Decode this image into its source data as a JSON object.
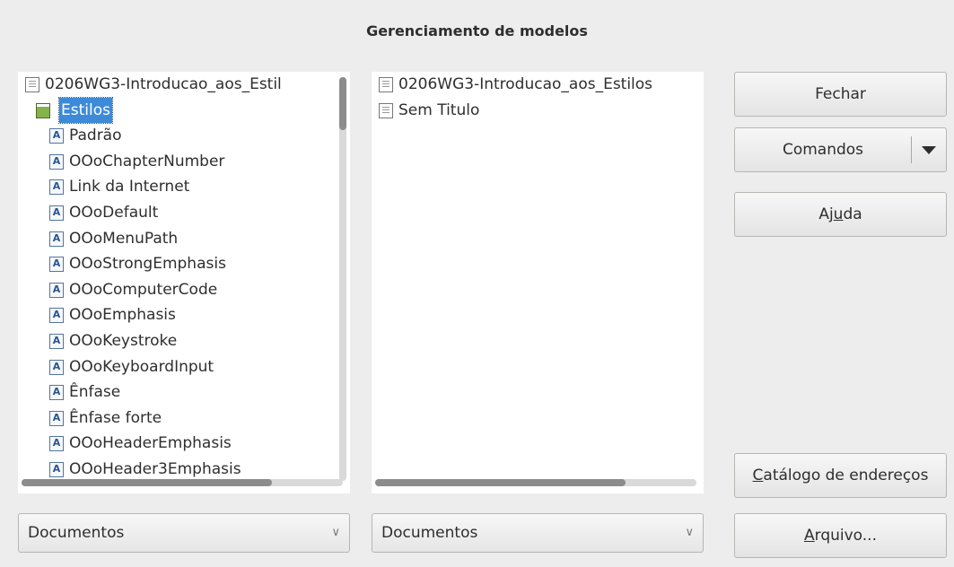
{
  "dialog": {
    "title": "Gerenciamento de modelos"
  },
  "left_list": {
    "document": "0206WG3-Introducao_aos_Estil",
    "folder": "Estilos",
    "styles": [
      "Padrão",
      "OOoChapterNumber",
      "Link da Internet",
      "OOoDefault",
      "OOoMenuPath",
      "OOoStrongEmphasis",
      "OOoComputerCode",
      "OOoEmphasis",
      "OOoKeystroke",
      "OOoKeyboardInput",
      "Ênfase",
      "Ênfase forte",
      "OOoHeaderEmphasis",
      "OOoHeader3Emphasis"
    ],
    "style_icon_glyph": "A",
    "scroll": {
      "vertical_position": 0.0,
      "vertical_visible_fraction": 0.13,
      "horizontal_visible_fraction": 0.78
    }
  },
  "right_list": {
    "items": [
      "0206WG3-Introducao_aos_Estilos",
      "Sem Titulo"
    ],
    "scroll": {
      "horizontal_visible_fraction": 0.78
    }
  },
  "buttons": {
    "close": "Fechar",
    "commands": "Comandos",
    "help_prefix": "Aj",
    "help_accel": "u",
    "help_suffix": "da",
    "address_book_accel": "C",
    "address_book_rest": "atálogo de endereços",
    "file_accel": "A",
    "file_rest": "rquivo..."
  },
  "selectors": {
    "left": "Documentos",
    "right": "Documentos",
    "chevron": "∨"
  },
  "colors": {
    "selection": "#3d8bd8",
    "dialog_bg": "#ededed"
  }
}
